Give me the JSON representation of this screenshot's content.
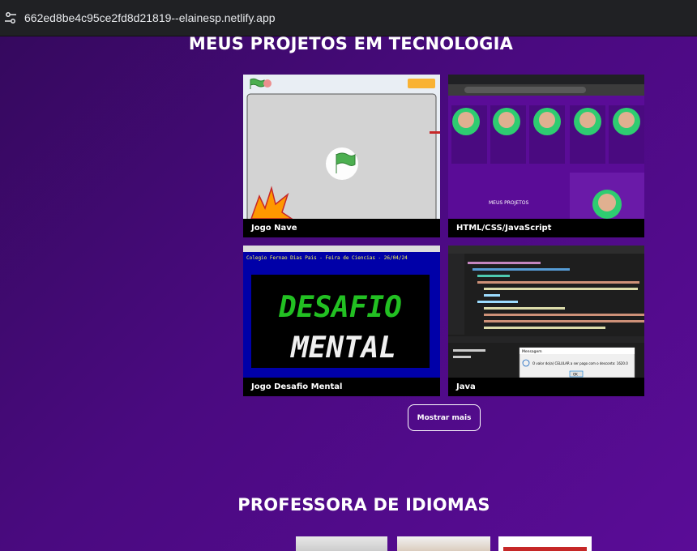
{
  "browser": {
    "url": "662ed8be4c95ce2fd8d21819--elainesp.netlify.app",
    "icon": "tune-icon"
  },
  "tech_section": {
    "title": "MEUS PROJETOS EM TECNOLOGIA",
    "projects": [
      {
        "caption": "Jogo Nave"
      },
      {
        "caption": "HTML/CSS/JavaScript"
      },
      {
        "caption": "Jogo Desafio Mental"
      },
      {
        "caption": "Java"
      }
    ],
    "show_more": "Mostrar mais"
  },
  "thumb_text": {
    "desafio_line1": "DESAFIO",
    "desafio_line2": "MENTAL",
    "desafio_header": "Colegio Fernao Dias Pais - Feira de Ciencias - 26/04/24",
    "html_thumb_label": "MEUS PROJETOS",
    "java_dialog_title": "Mensagem",
    "java_dialog_text": "O valor do(a) CELULAR a ser pago com o desconto: 1620.0",
    "java_dialog_ok": "OK"
  },
  "lang_section": {
    "title": "PROFESSORA DE IDIOMAS"
  }
}
